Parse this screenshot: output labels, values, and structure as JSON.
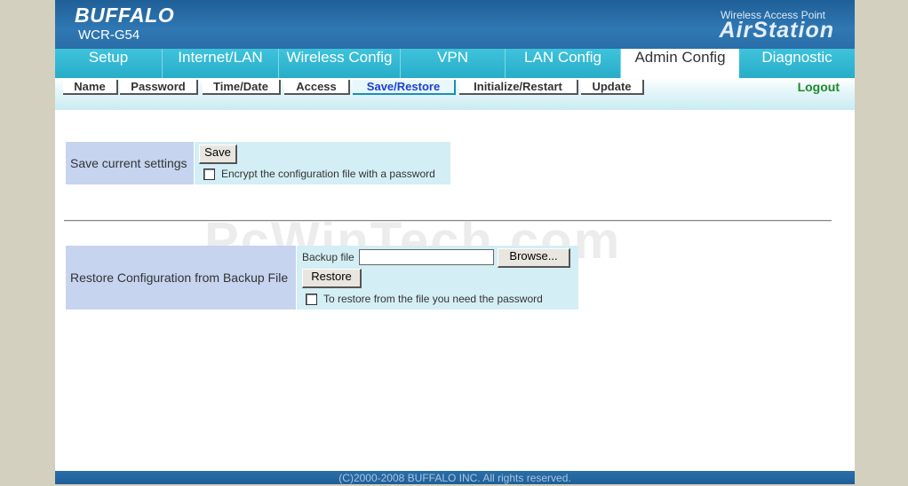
{
  "header": {
    "brand": "BUFFALO",
    "model": "WCR-G54",
    "subtitle": "Wireless Access Point",
    "product": "AirStation"
  },
  "tabs": [
    {
      "label": "Setup"
    },
    {
      "label": "Internet/LAN"
    },
    {
      "label": "Wireless Config"
    },
    {
      "label": "VPN"
    },
    {
      "label": "LAN Config"
    },
    {
      "label": "Admin Config",
      "active": true
    },
    {
      "label": "Diagnostic"
    }
  ],
  "subnav": {
    "items": [
      {
        "label": "Name"
      },
      {
        "label": "Password"
      },
      {
        "label": "Time/Date"
      },
      {
        "label": "Access"
      },
      {
        "label": "Save/Restore",
        "active": true
      },
      {
        "label": "Initialize/Restart"
      },
      {
        "label": "Update"
      }
    ],
    "logout": "Logout"
  },
  "save_section": {
    "label": "Save current settings",
    "save_button": "Save",
    "encrypt_checkbox_label": "Encrypt the configuration file with a password",
    "encrypt_checked": false
  },
  "restore_section": {
    "label": "Restore Configuration from Backup File",
    "file_label": "Backup file",
    "file_value": "",
    "browse_button": "Browse...",
    "restore_button": "Restore",
    "password_checkbox_label": "To restore from the file you need the password",
    "password_checked": false
  },
  "watermark": "PcWinTech.com",
  "footer": "(C)2000-2008 BUFFALO INC. All rights reserved.",
  "colors": {
    "header_blue": "#2a6ea8",
    "tab_cyan": "#28adc9",
    "active_subnav": "#1a3fd0",
    "logout_green": "#1c8a2c",
    "label_bg": "#c6d4ef",
    "pane_bg": "#d4eef5"
  }
}
